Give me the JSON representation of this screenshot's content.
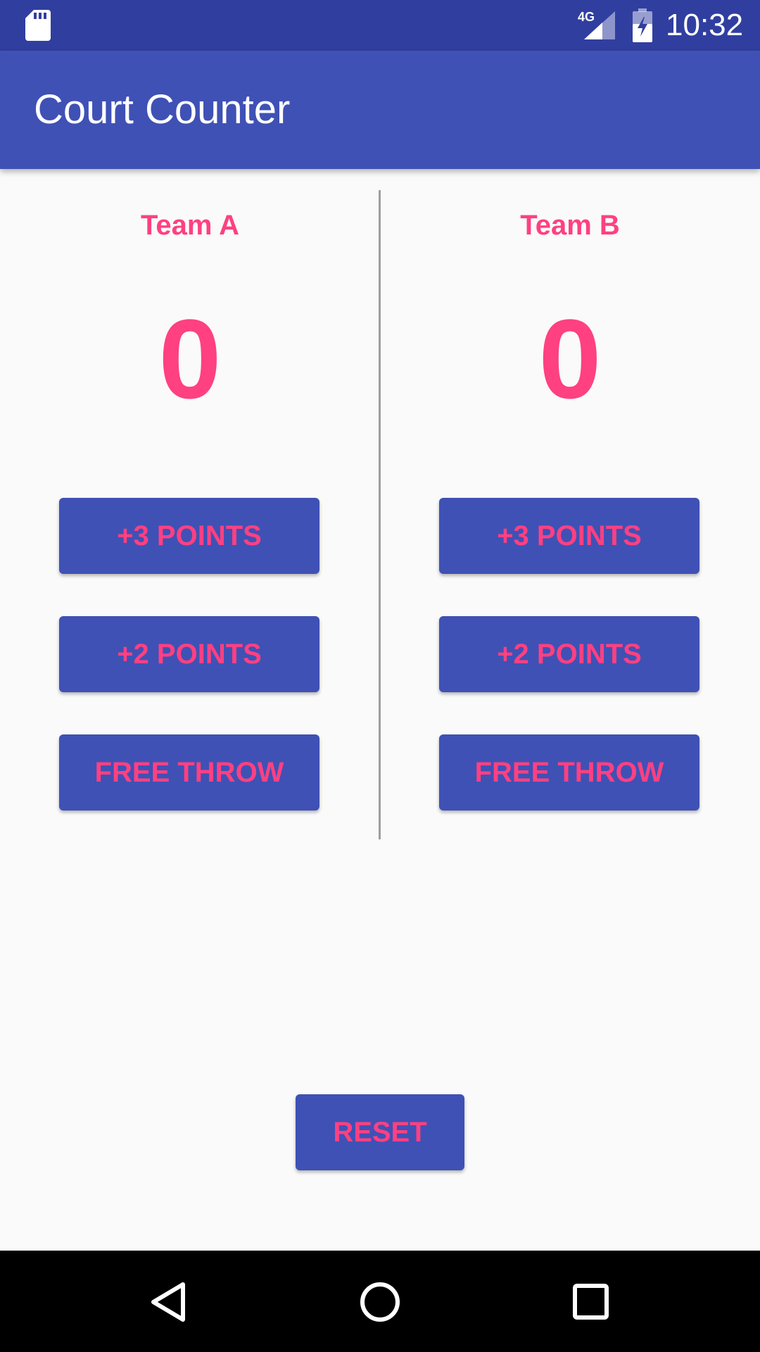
{
  "status_bar": {
    "time": "10:32",
    "network": "4G",
    "icons": [
      "sd-card-icon",
      "signal-4g-icon",
      "battery-charging-icon"
    ]
  },
  "app_bar": {
    "title": "Court Counter"
  },
  "team_a": {
    "name": "Team A",
    "score": "0",
    "buttons": {
      "plus3": "+3 POINTS",
      "plus2": "+2 POINTS",
      "free_throw": "FREE THROW"
    }
  },
  "team_b": {
    "name": "Team B",
    "score": "0",
    "buttons": {
      "plus3": "+3 POINTS",
      "plus2": "+2 POINTS",
      "free_throw": "FREE THROW"
    }
  },
  "reset_label": "RESET",
  "nav_bar": {
    "icons": [
      "back-icon",
      "home-icon",
      "recents-icon"
    ]
  },
  "colors": {
    "primary": "#3F51B5",
    "primary_dark": "#303F9F",
    "accent": "#FF4081",
    "background": "#FAFAFA"
  }
}
